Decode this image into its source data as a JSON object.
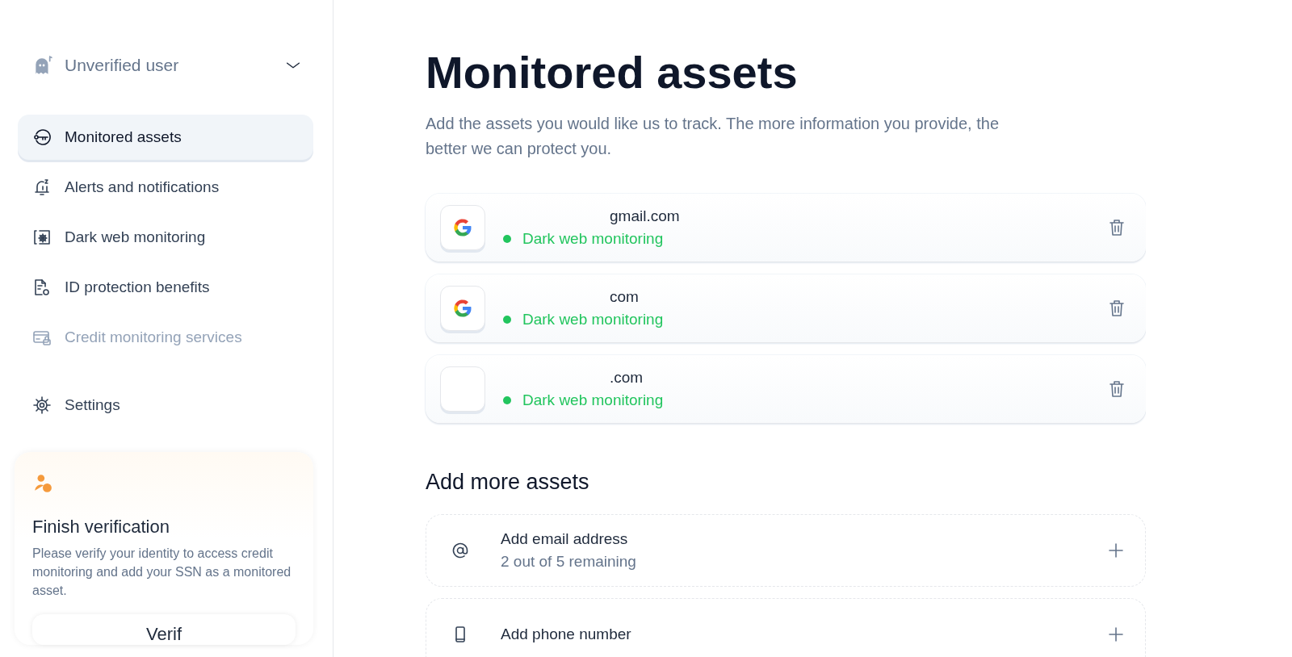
{
  "user_menu": {
    "label": "Unverified user",
    "expanded": false
  },
  "nav": [
    {
      "label": "Monitored assets",
      "kind": "key",
      "selected": true,
      "disabled": false
    },
    {
      "label": "Alerts and notifications",
      "kind": "bell",
      "selected": false,
      "disabled": false
    },
    {
      "label": "Dark web monitoring",
      "kind": "web",
      "selected": false,
      "disabled": false
    },
    {
      "label": "ID protection benefits",
      "kind": "doc",
      "selected": false,
      "disabled": false
    },
    {
      "label": "Credit monitoring services",
      "kind": "card",
      "selected": false,
      "disabled": true
    }
  ],
  "settings": {
    "label": "Settings"
  },
  "verification_card": {
    "title": "Finish verification",
    "text": "Please verify your identity to access credit monitoring and add your SSN as a monitored asset.",
    "button": "Verif"
  },
  "page": {
    "title": "Monitored assets",
    "subtitle": "Add the assets you would like us to track. The more information you provide, the better we can protect you."
  },
  "assets": [
    {
      "kind": "google",
      "value": "gmail.com",
      "status": "Dark web monitoring",
      "color": "#22c55e"
    },
    {
      "kind": "google",
      "value": "com",
      "status": "Dark web monitoring",
      "color": "#22c55e"
    },
    {
      "kind": "blank",
      "value": ".com",
      "status": "Dark web monitoring",
      "color": "#22c55e"
    }
  ],
  "add_section": {
    "title": "Add more assets",
    "items": [
      {
        "kind": "email",
        "label": "Add email address",
        "remaining": "2 out of 5 remaining"
      },
      {
        "kind": "phone",
        "label": "Add phone number"
      }
    ]
  }
}
